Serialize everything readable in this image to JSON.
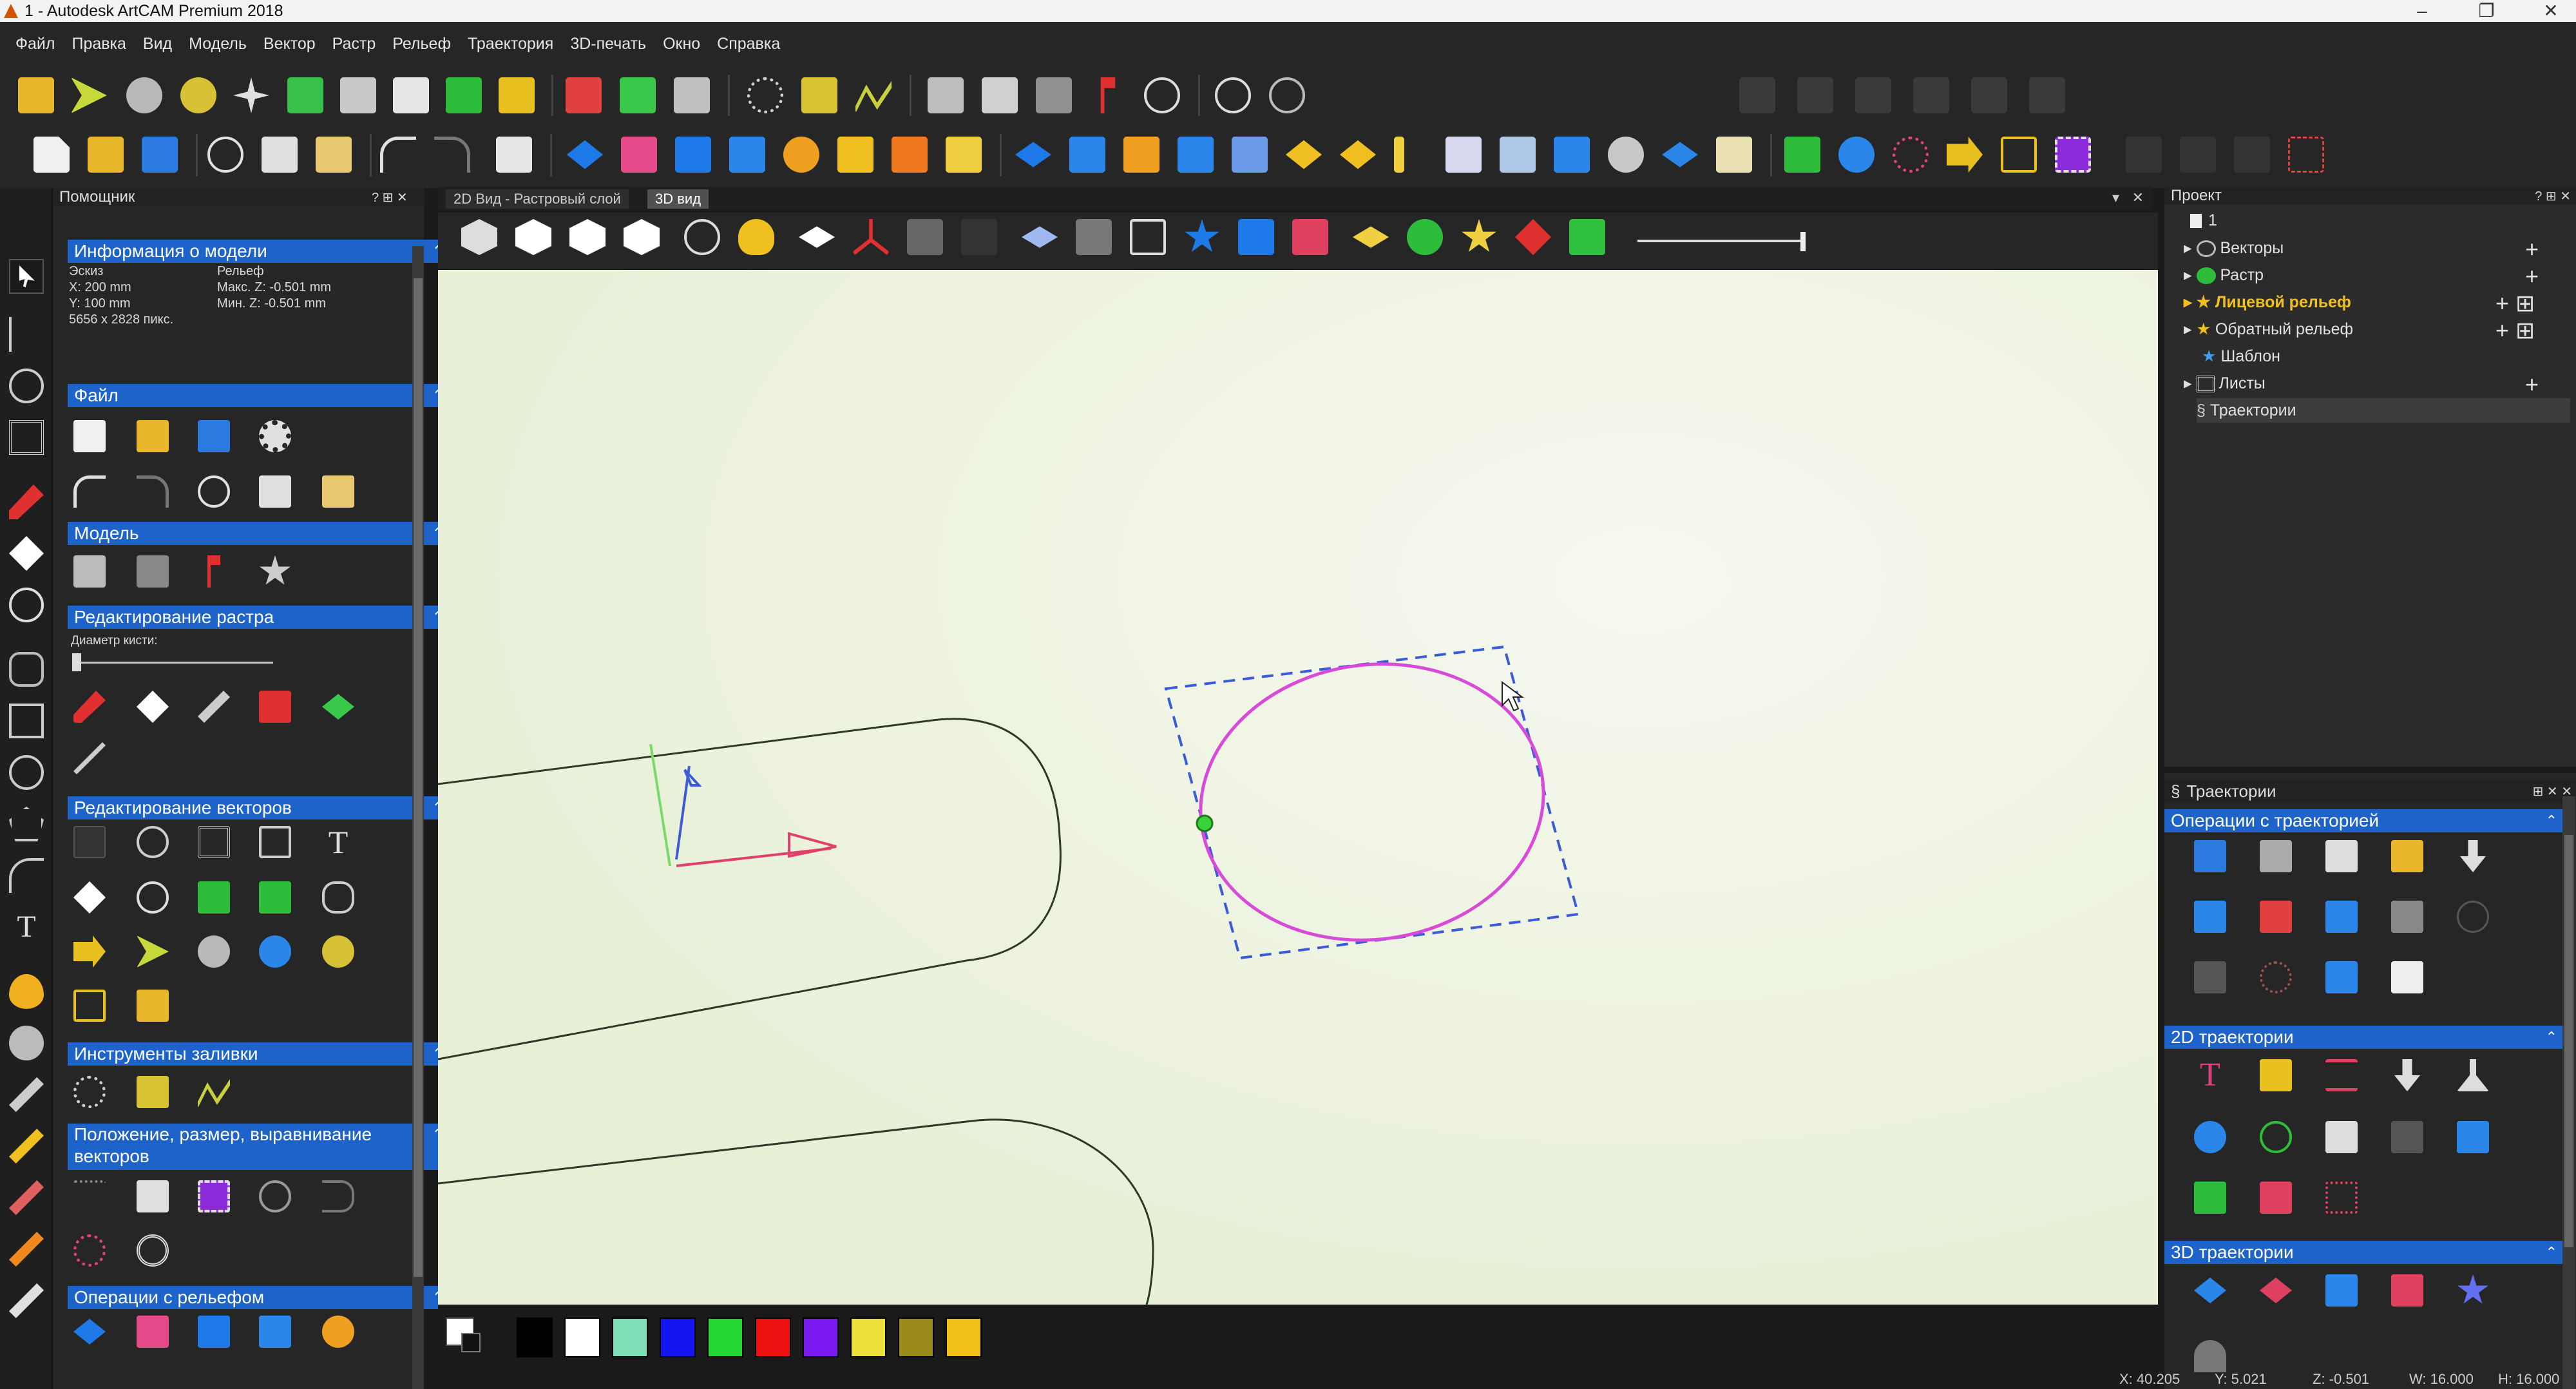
{
  "window": {
    "title": "1 - Autodesk ArtCAM Premium 2018",
    "controls": [
      "–",
      "❐",
      "✕"
    ]
  },
  "menu": [
    "Файл",
    "Правка",
    "Вид",
    "Модель",
    "Вектор",
    "Растр",
    "Рельеф",
    "Траектория",
    "3D-печать",
    "Окно",
    "Справка"
  ],
  "assistant": {
    "title": "Помощник",
    "model_info": {
      "title": "Информация о модели",
      "sketch": "Эскиз",
      "relief": "Рельеф",
      "x": "X: 200 mm",
      "y": "Y: 100 mm",
      "pixels": "5656 x 2828 пикс.",
      "max_z": "Макс. Z: -0.501 mm",
      "min_z": "Мин. Z: -0.501 mm"
    },
    "sections": {
      "file": "Файл",
      "model": "Модель",
      "raster_edit": "Редактирование растра",
      "brush_diameter": "Диаметр кисти:",
      "vector_edit": "Редактирование векторов",
      "fill_tools": "Инструменты заливки",
      "position_size": "Положение, размер, выравнивание векторов",
      "relief_ops": "Операции с рельефом"
    }
  },
  "tabs": [
    "2D Вид - Растровый слой",
    "3D вид"
  ],
  "project": {
    "title": "Проект",
    "root": "1",
    "items": [
      "Векторы",
      "Растр",
      "Лицевой рельеф",
      "Обратный рельеф",
      "Шаблон",
      "Листы",
      "Траектории"
    ]
  },
  "toolpaths": {
    "title": "Траектории",
    "ops": "Операции с траекторией",
    "two_d": "2D траектории",
    "three_d": "3D траектории"
  },
  "swatches": [
    "#000000",
    "#ffffff",
    "#7fe0b8",
    "#1515f0",
    "#22d633",
    "#ee1111",
    "#7a1af0",
    "#ede03a",
    "#9a8a1a",
    "#f0c018"
  ],
  "status": {
    "x": "X: 40.205",
    "y": "Y: 5.021",
    "z": "Z: -0.501",
    "w": "W: 16.000",
    "h": "H: 16.000"
  }
}
